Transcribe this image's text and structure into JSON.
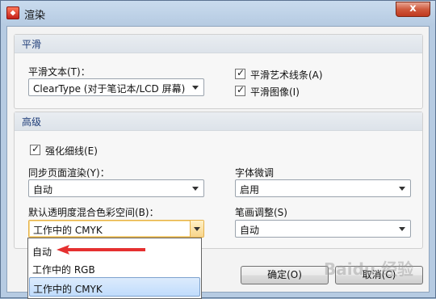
{
  "window": {
    "title": "渲染",
    "close_label": "x"
  },
  "smooth_group": {
    "title": "平滑",
    "text_label": "平滑文本(T)：",
    "text_value": "ClearType (对于笔记本/LCD 屏幕)",
    "line_art_label": "平滑艺术线条(A)",
    "line_art_checked": "✓",
    "images_label": "平滑图像(I)",
    "images_checked": "✓"
  },
  "advanced_group": {
    "title": "高级",
    "enhance_thin_label": "强化细线(E)",
    "enhance_thin_checked": "✓",
    "sync_page_label": "同步页面渲染(Y)：",
    "sync_page_value": "自动",
    "font_hint_label": "字体微调",
    "font_hint_value": "启用",
    "blend_space_label": "默认透明度混合色彩空间(B)：",
    "blend_space_value": "工作中的 CMYK",
    "stroke_adjust_label": "笔画调整(S)",
    "stroke_adjust_value": "自动"
  },
  "buttons": {
    "ok": "确定(O)",
    "cancel": "取消(C)"
  },
  "dropdown_options": [
    "自动",
    "工作中的 RGB",
    "工作中的 CMYK"
  ],
  "annotation_color": "#e53030",
  "watermark": "Baidu 经验"
}
